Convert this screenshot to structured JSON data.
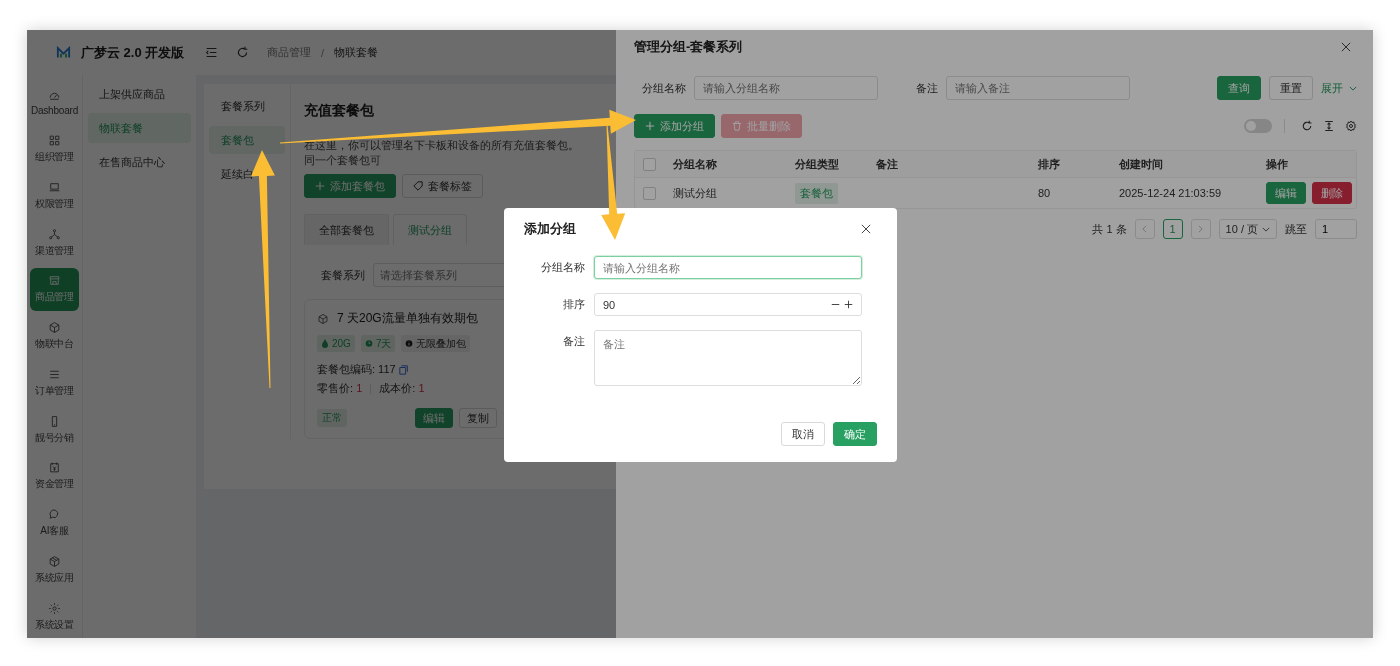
{
  "app": {
    "brand": "广梦云 2.0 开发版",
    "breadcrumb": [
      "商品管理",
      "物联套餐"
    ],
    "breadcrumb_separator": "/"
  },
  "nav": [
    {
      "label": "Dashboard",
      "selected": false
    },
    {
      "label": "组织管理",
      "selected": false
    },
    {
      "label": "权限管理",
      "selected": false
    },
    {
      "label": "渠道管理",
      "selected": false
    },
    {
      "label": "商品管理",
      "selected": true
    },
    {
      "label": "物联中台",
      "selected": false
    },
    {
      "label": "订单管理",
      "selected": false
    },
    {
      "label": "靓号分销",
      "selected": false
    },
    {
      "label": "资金管理",
      "selected": false
    },
    {
      "label": "AI客服",
      "selected": false
    },
    {
      "label": "系统应用",
      "selected": false
    },
    {
      "label": "系统设置",
      "selected": false
    }
  ],
  "submenu": [
    {
      "label": "上架供应商品",
      "selected": false
    },
    {
      "label": "物联套餐",
      "selected": true
    },
    {
      "label": "在售商品中心",
      "selected": false
    }
  ],
  "subnav": [
    {
      "label": "套餐系列",
      "selected": false
    },
    {
      "label": "套餐包",
      "selected": true
    },
    {
      "label": "延续白",
      "selected": false
    }
  ],
  "page": {
    "title": "充值套餐包",
    "description": "在这里，你可以管理名下卡板和设备的所有充值套餐包。同一个套餐包可",
    "add_button": "添加套餐包",
    "tag_button": "套餐标签",
    "tabs": [
      {
        "label": "全部套餐包",
        "selected": false
      },
      {
        "label": "测试分组",
        "selected": true
      }
    ],
    "filter": {
      "label": "套餐系列",
      "placeholder": "请选择套餐系列"
    },
    "package": {
      "name": "7 天20G流量单独有效期包",
      "tags": [
        {
          "text": "20G",
          "kind": "data"
        },
        {
          "text": "7天",
          "kind": "time"
        },
        {
          "text": "无限叠加包",
          "kind": "info"
        }
      ],
      "code_label": "套餐包编码:",
      "code": "117",
      "retail_label": "零售价:",
      "retail": "1",
      "cost_label": "成本价:",
      "cost": "1",
      "status": "正常",
      "actions": [
        "编辑",
        "复制"
      ]
    }
  },
  "drawer": {
    "title": "管理分组-套餐系列",
    "search": [
      {
        "label": "分组名称",
        "placeholder": "请输入分组名称"
      },
      {
        "label": "备注",
        "placeholder": "请输入备注"
      }
    ],
    "query": "查询",
    "reset": "重置",
    "expand": "展开",
    "add": "添加分组",
    "batch_delete": {
      "label": "批量删除",
      "disabled": true
    },
    "switch_on": false,
    "table": {
      "all_checked": false,
      "columns": [
        "分组名称",
        "分组类型",
        "备注",
        "排序",
        "创建时间",
        "操作"
      ],
      "rows": [
        {
          "checked": false,
          "name": "测试分组",
          "type": "套餐包",
          "order": "80",
          "created": "2025-12-24 21:03:59",
          "actions": [
            "编辑",
            "删除"
          ]
        }
      ]
    },
    "pagination": {
      "total": "共 1 条",
      "pages": [
        {
          "label": "1",
          "selected": true
        }
      ],
      "page_size": "10 / 页",
      "jump_label": "跳至",
      "jump_value": "1"
    }
  },
  "dialog": {
    "title": "添加分组",
    "fields": [
      {
        "kind": "text",
        "label": "分组名称",
        "placeholder": "请输入分组名称",
        "focused": true
      },
      {
        "kind": "number",
        "label": "排序",
        "value": "90"
      },
      {
        "kind": "textarea",
        "label": "备注",
        "placeholder": "备注"
      }
    ],
    "cancel": "取消",
    "confirm": "确定"
  }
}
